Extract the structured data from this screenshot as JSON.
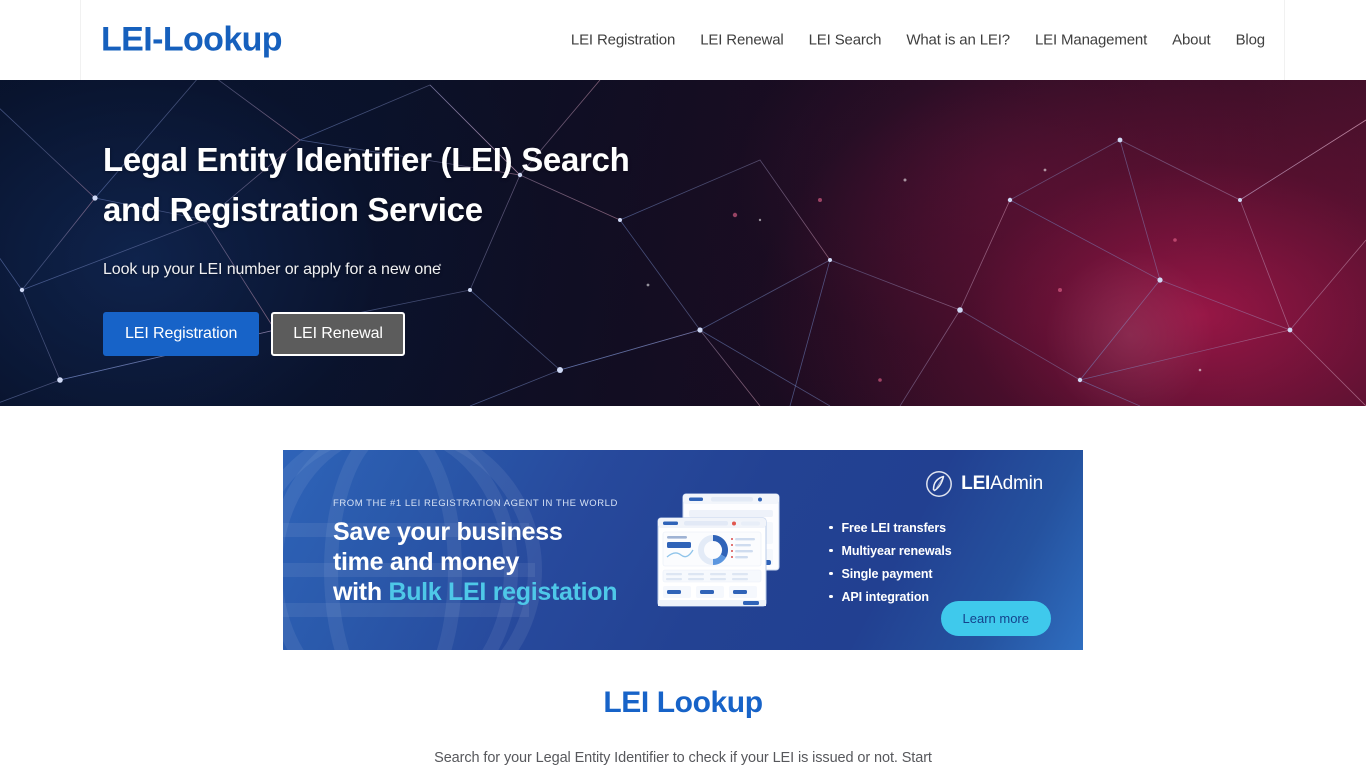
{
  "header": {
    "brand": "LEI-Lookup",
    "nav": [
      {
        "label": "LEI Registration"
      },
      {
        "label": "LEI Renewal"
      },
      {
        "label": "LEI Search"
      },
      {
        "label": "What is an LEI?"
      },
      {
        "label": "LEI Management"
      },
      {
        "label": "About"
      },
      {
        "label": "Blog"
      }
    ]
  },
  "hero": {
    "title_line1": "Legal Entity Identifier (LEI) Search",
    "title_line2": "and Registration Service",
    "subtitle": "Look up your LEI number or apply for a new one",
    "primary_button": "LEI Registration",
    "secondary_button": "LEI Renewal",
    "colors": {
      "primary_button_bg": "#1763c8",
      "secondary_button_bg": "#5c5c5c",
      "background_left": "#081229",
      "background_right": "#46112b"
    }
  },
  "banner": {
    "kicker": "FROM THE #1 LEI REGISTRATION AGENT IN THE WORLD",
    "headline_line1": "Save your business",
    "headline_line2": "time and money",
    "headline_line3_prefix": "with ",
    "headline_line3_highlight": "Bulk LEI registation",
    "logo_bold": "LEI",
    "logo_light": "Admin",
    "bullets": [
      {
        "label": "Free LEI transfers"
      },
      {
        "label": "Multiyear renewals"
      },
      {
        "label": "Single payment"
      },
      {
        "label": "API integration"
      }
    ],
    "cta": "Learn more",
    "colors": {
      "background": "#234293",
      "highlight_text": "#4ec8e8",
      "cta_bg": "#3fc9ec",
      "cta_text": "#14428c"
    }
  },
  "lookup": {
    "title": "LEI Lookup",
    "description": "Search for your Legal Entity Identifier to check if your LEI is issued or not. Start",
    "title_color": "#1763c8"
  }
}
